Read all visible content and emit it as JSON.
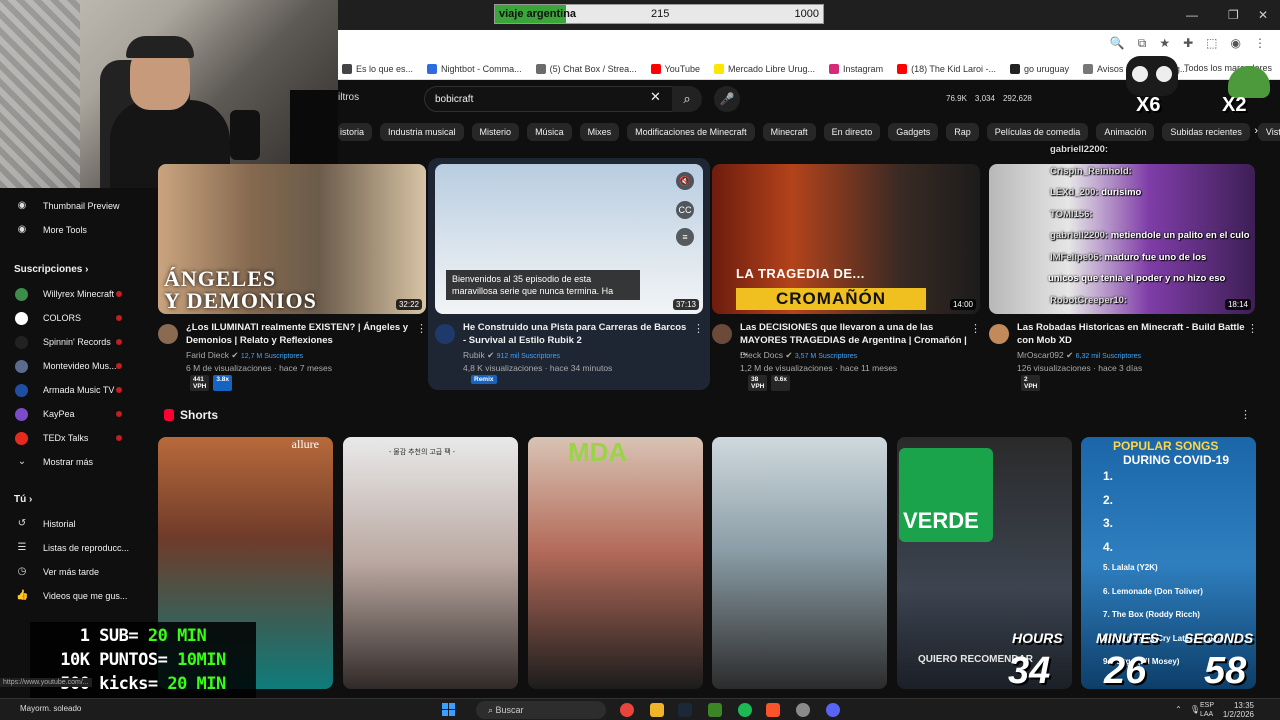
{
  "goal_bar": {
    "label": "viaje argentina",
    "current": "215",
    "goal": "1000",
    "fraction": 0.215
  },
  "window_controls": {
    "minimize": "—",
    "restore": "❐",
    "close": "✕"
  },
  "bookmarks": {
    "items": [
      {
        "label": "Es lo que es...",
        "color": "#444444"
      },
      {
        "label": "Nightbot - Comma...",
        "color": "#2d6cdf"
      },
      {
        "label": "(5) Chat Box / Strea...",
        "color": "#6b6b6b"
      },
      {
        "label": "YouTube",
        "color": "#ff0000"
      },
      {
        "label": "Mercado Libre Urug...",
        "color": "#ffe600"
      },
      {
        "label": "Instagram",
        "color": "#d62976"
      },
      {
        "label": "(18) The Kid Laroi -...",
        "color": "#ff0000"
      },
      {
        "label": "go uruguay",
        "color": "#222222"
      },
      {
        "label": "Avisos clasificados g...",
        "color": "#777777"
      }
    ],
    "all_label": "Todos los marcadores"
  },
  "header": {
    "filters_label": "iltros",
    "search_value": "bobicraft",
    "stats": [
      "76.9K",
      "3,034",
      "292,628"
    ]
  },
  "chips": [
    "istoria",
    "Industria musical",
    "Misterio",
    "Música",
    "Mixes",
    "Modificaciones de Minecraft",
    "Minecraft",
    "En directo",
    "Gadgets",
    "Rap",
    "Películas de comedia",
    "Animación",
    "Subidas recientes",
    "Visto"
  ],
  "sidebar": {
    "tools": [
      {
        "label": "Thumbnail Preview"
      },
      {
        "label": "More Tools"
      }
    ],
    "subs_header": "Suscripciones",
    "subscriptions": [
      {
        "label": "Willyrex Minecraft",
        "color": "#3c8c4c"
      },
      {
        "label": "COLORS",
        "color": "#ffffff"
      },
      {
        "label": "Spinnin' Records",
        "color": "#222222"
      },
      {
        "label": "Montevideo Mus...",
        "color": "#5a6b8c"
      },
      {
        "label": "Armada Music TV",
        "color": "#1e4fa3"
      },
      {
        "label": "KayPea",
        "color": "#7b4bc9"
      },
      {
        "label": "TEDx Talks",
        "color": "#e62b1e"
      }
    ],
    "show_more": "Mostrar más",
    "you_header": "Tú",
    "you_items": [
      {
        "label": "Historial"
      },
      {
        "label": "Listas de reproducc..."
      },
      {
        "label": "Ver más tarde"
      },
      {
        "label": "Videos que me gus..."
      }
    ]
  },
  "videos": [
    {
      "title": "¿Los ILUMINATI realmente EXISTEN? | Ángeles y Demonios | Relato y Reflexiones",
      "channel": "Farid Dieck",
      "subs": "12,7 M Suscriptores",
      "meta": "6 M de visualizaciones · hace 7 meses",
      "duration": "32:22",
      "badges": [
        "441 VPH",
        "3.8x"
      ],
      "overlay": "ÁNGELES\nY DEMONIOS"
    },
    {
      "title": "He Construido una Pista para Carreras de Barcos - Survival al Estilo Rubik 2",
      "channel": "Rubik",
      "subs": "912 mil Suscriptores",
      "meta": "4,8 K visualizaciones · hace 34 minutos",
      "duration": "37:13",
      "badges": [
        "Remix"
      ],
      "caption": "Bienvenidos al 35 episodio de esta maravillosa serie que nunca termina. Ha"
    },
    {
      "title": "Las DECISIONES que llevaron a una de las MAYORES TRAGEDIAS de Argentina | Cromañón | ...",
      "channel": "Dieck Docs",
      "subs": "3,57 M Suscriptores",
      "meta": "1,2 M de visualizaciones · hace 11 meses",
      "duration": "14:00",
      "badges": [
        "38 VPH",
        "0.6x"
      ],
      "overlay_top": "LA TRAGEDIA DE...",
      "overlay_banner": "CROMAÑÓN"
    },
    {
      "title": "Las Robadas Historicas en Minecraft - Build Battle con Mob XD",
      "channel": "MrOscar092",
      "subs": "6,32 mil Suscriptores",
      "meta": "126 visualizaciones · hace 3 días",
      "duration": "18:14",
      "badges": [
        "2 VPH"
      ]
    }
  ],
  "chat": [
    {
      "user": "gabriell2200:",
      "msg": ""
    },
    {
      "user": "Crispin_Reinhold:",
      "msg": ""
    },
    {
      "user": "LEXd_200:",
      "msg": "durisimo"
    },
    {
      "user": "TOMI156:",
      "msg": ""
    },
    {
      "user": "gabriell2200:",
      "msg": "metiendole un palito en el culo"
    },
    {
      "user": "IMFelipe06:",
      "msg": "maduro fue uno de los"
    },
    {
      "user": "",
      "msg": "unicos que tenia el poder y no hizo eso"
    },
    {
      "user": "RobotCreeper10:",
      "msg": ""
    }
  ],
  "shorts": {
    "header": "Shorts",
    "s1_text": "allure",
    "s2_text": "- 물감 추천의 고급 팩 -",
    "s3_text": "MDA",
    "s5_verde": "VERDE",
    "s5_sub": "QUIERO RECOMENDAR",
    "s6_title1": "POPULAR SONGS",
    "s6_title2": "DURING COVID-19",
    "s6_list": [
      "1.",
      "2.",
      "3.",
      "4.",
      "5. Lalala (Y2K)",
      "6. Lemonade (Don Toliver)",
      "7. The Box (Roddy Ricch)",
      "8. Laugh Now Cry Later (Drake)",
      "9. Faygo (Lil Mosey)"
    ]
  },
  "timer": {
    "hours_label": "HOURS",
    "minutes_label": "MINUTES",
    "seconds_label": "SECONDS",
    "hours": "34",
    "minutes": "26",
    "seconds": "58"
  },
  "multipliers": {
    "owl": "X6",
    "frog": "X2"
  },
  "promo": [
    {
      "text": "1 SUB= ",
      "accent": "20 MIN"
    },
    {
      "text": "10K PUNTOS= ",
      "accent": "10MIN"
    },
    {
      "text": "500 kicks= ",
      "accent": "20 MIN"
    }
  ],
  "taskbar": {
    "weather": "Mayorm. soleado",
    "search": "Buscar",
    "lang": [
      "ESP",
      "LAA"
    ],
    "time": "13:35",
    "date": "1/2/2026"
  },
  "status_url": "https://www.youtube.com/..."
}
